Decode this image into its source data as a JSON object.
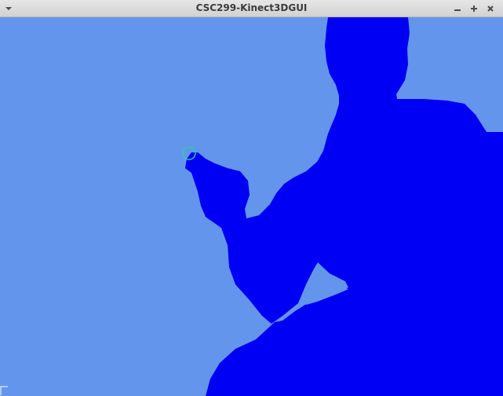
{
  "window": {
    "title": "CSC299-Kinect3DGUI"
  },
  "icons": {
    "menu": "chevron-down-icon",
    "minimize": "minimize-icon",
    "maximize": "maximize-icon",
    "close": "close-icon"
  },
  "colors": {
    "background": "#6495ed",
    "depth_region": "#0000f5",
    "hand_marker": "#22d3a0",
    "corner_marker": "#ffffff"
  }
}
